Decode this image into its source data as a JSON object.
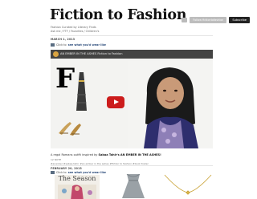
{
  "header": {
    "blog_title": "Fiction to Fashion",
    "follow_label": "Follow fictiontofashion",
    "subscribe_label": "Subscribe",
    "curated_by": "Fashion Curated by Literary Finds",
    "nav_line": "Ask me  /  FTF  /  Favorites  /  Children's"
  },
  "post1": {
    "date": "MARCH 1, 2013",
    "video_link_prefix": "Click to",
    "video_link_bold": "see what you'd wear like",
    "video_title": "AN EMBER IN THE ASHES Fiction to Fashion",
    "caption_prefix": "A regal Romans outfit inspired by",
    "caption_bold": "Sabaa Tahir's AN EMBER IN THE ASHES!",
    "notes": "12 NOTE",
    "tags": "#ananber  #sabaa tahir  #an ember in the ashes  #fiction to fashion  #book trailer"
  },
  "post2": {
    "date": "FEBRUARY 20, 2013",
    "video_link_prefix": "Click to",
    "video_link_bold": "see what you'd wear like",
    "book_title": "The Season"
  },
  "colors": {
    "play": "#cc1c1c",
    "subscribe": "#222222",
    "follow": "#bdbdbd",
    "link": "#2a4a7a"
  }
}
